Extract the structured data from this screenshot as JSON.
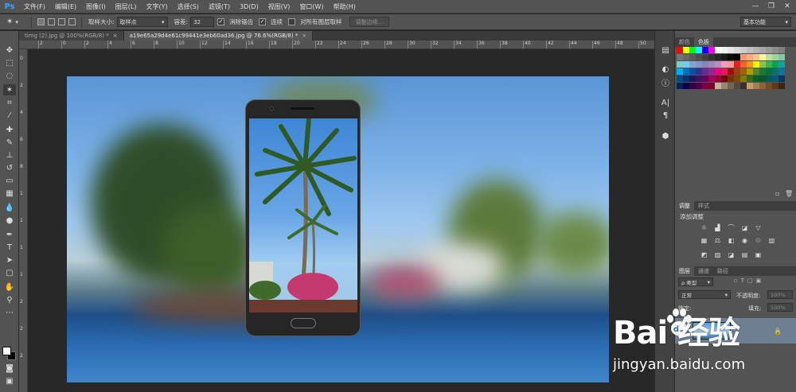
{
  "app": {
    "logo": "Ps"
  },
  "menu": [
    "文件(F)",
    "编辑(E)",
    "图像(I)",
    "图层(L)",
    "文字(Y)",
    "选择(S)",
    "滤镜(T)",
    "3D(D)",
    "视图(V)",
    "窗口(W)",
    "帮助(H)"
  ],
  "options": {
    "sample_size_label": "取样大小:",
    "sample_size_value": "取样点",
    "tolerance_label": "容差:",
    "tolerance_value": "32",
    "antialias_label": "消除锯齿",
    "contiguous_label": "连续",
    "sample_all_label": "对所有图层取样",
    "refine_edge_label": "调整边缘...",
    "workspace": "基本功能"
  },
  "tabs": [
    {
      "label": "timg (2).jpg @ 100%(RGB/8) *",
      "close": "×"
    },
    {
      "label": "a19e65a29d4e61c99441e3eb60ad36.jpg @ 76.6%(RGB/8) *",
      "close": "×"
    }
  ],
  "ruler_top": [
    "2",
    "0",
    "2",
    "4",
    "6",
    "8",
    "10",
    "12",
    "14",
    "16",
    "18",
    "20",
    "22",
    "24",
    "26",
    "28",
    "30",
    "32",
    "34",
    "36",
    "38",
    "40",
    "42",
    "44",
    "46",
    "48",
    "50"
  ],
  "ruler_left": [
    "0",
    "2",
    "4",
    "6",
    "8",
    "1",
    "1",
    "1",
    "1",
    "2",
    "2",
    "2"
  ],
  "panels": {
    "swatch_tabs": [
      "颜色",
      "色板"
    ],
    "adjust_tabs": [
      "调整",
      "样式"
    ],
    "adjust_title": "添加调整",
    "layer_tabs": [
      "图层",
      "通道",
      "路径"
    ],
    "kind_label": "ρ 类型",
    "blend_mode": "正常",
    "opacity_label": "不透明度:",
    "opacity_value": "100%",
    "lock_label": "锁定:",
    "fill_label": "填充:",
    "fill_value": "100%"
  },
  "colors": {
    "ui_dark": "#535353",
    "canvas_bg": "#282828",
    "active_layer": "#6e7f91",
    "fg_color": "#ffffff",
    "bg_color": "#000000"
  },
  "watermark": {
    "logo": "Bai 经验",
    "url": "jingyan.baidu.com"
  }
}
